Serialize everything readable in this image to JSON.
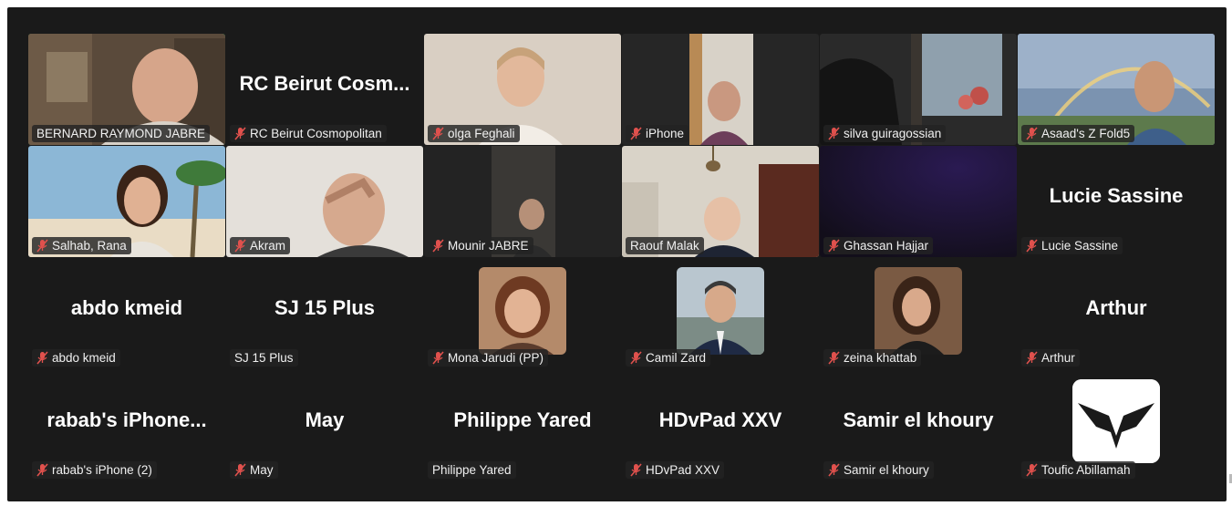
{
  "participants": [
    {
      "name": "BERNARD RAYMOND  JABRE",
      "muted": false,
      "video": true,
      "active": true
    },
    {
      "name": "RC Beirut Cosmopolitan",
      "display": "RC Beirut Cosm...",
      "muted": true,
      "video": false
    },
    {
      "name": "olga Feghali",
      "muted": true,
      "video": true
    },
    {
      "name": "iPhone",
      "muted": true,
      "video": true
    },
    {
      "name": "silva guiragossian",
      "muted": true,
      "video": true
    },
    {
      "name": "Asaad's Z Fold5",
      "muted": true,
      "video": true
    },
    {
      "name": "Salhab, Rana",
      "muted": true,
      "video": true
    },
    {
      "name": "Akram",
      "muted": true,
      "video": true
    },
    {
      "name": "Mounir JABRE",
      "muted": true,
      "video": true
    },
    {
      "name": "Raouf Malak",
      "muted": false,
      "video": true
    },
    {
      "name": "Ghassan Hajjar",
      "muted": true,
      "video": true
    },
    {
      "name": "Lucie Sassine",
      "display": "Lucie Sassine",
      "muted": true,
      "video": false
    },
    {
      "name": "abdo kmeid",
      "display": "abdo kmeid",
      "muted": true,
      "video": false
    },
    {
      "name": "SJ 15 Plus",
      "display": "SJ 15 Plus",
      "muted": false,
      "video": false
    },
    {
      "name": "Mona Jarudi (PP)",
      "muted": true,
      "video": false,
      "avatar": "photo"
    },
    {
      "name": "Camil Zard",
      "muted": true,
      "video": false,
      "avatar": "photo"
    },
    {
      "name": "zeina khattab",
      "muted": true,
      "video": false,
      "avatar": "photo"
    },
    {
      "name": "Arthur",
      "display": "Arthur",
      "muted": true,
      "video": false
    },
    {
      "name": "rabab's iPhone (2)",
      "display": "rabab's  iPhone...",
      "muted": true,
      "video": false
    },
    {
      "name": "May",
      "display": "May",
      "muted": true,
      "video": false
    },
    {
      "name": "Philippe Yared",
      "display": "Philippe Yared",
      "muted": false,
      "video": false
    },
    {
      "name": "HDvPad XXV",
      "display": "HDvPad XXV",
      "muted": true,
      "video": false
    },
    {
      "name": "Samir el khoury",
      "display": "Samir el khoury",
      "muted": true,
      "video": false
    },
    {
      "name": "Toufic Abillamah",
      "muted": true,
      "video": false,
      "avatar": "logo"
    }
  ],
  "colors": {
    "background": "#1a1a1a",
    "active_speaker": "#23d96a",
    "muted_icon": "#e0514d",
    "label_bg": "#232323"
  },
  "icons": {
    "muted": "microphone-muted-icon"
  }
}
